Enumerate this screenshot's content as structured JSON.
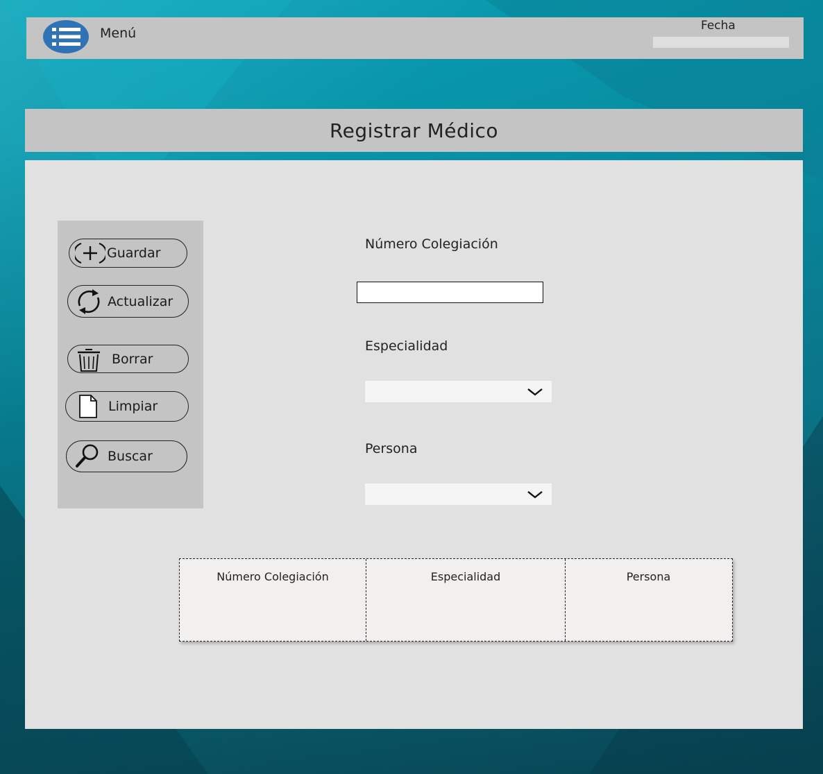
{
  "header": {
    "menu_label": "Menú",
    "date_label": "Fecha",
    "date_value": ""
  },
  "title": "Registrar Médico",
  "toolbar": {
    "buttons": [
      {
        "label": "Guardar",
        "icon": "plus-circle-icon"
      },
      {
        "label": "Actualizar",
        "icon": "refresh-icon"
      },
      {
        "label": "Borrar",
        "icon": "trash-icon"
      },
      {
        "label": "Limpiar",
        "icon": "document-icon"
      },
      {
        "label": "Buscar",
        "icon": "magnifier-icon"
      }
    ]
  },
  "form": {
    "numero_label": "Número Colegiación",
    "numero_value": "",
    "especialidad_label": "Especialidad",
    "especialidad_value": "",
    "persona_label": "Persona",
    "persona_value": ""
  },
  "table": {
    "columns": [
      "Número Colegiación",
      "Especialidad",
      "Persona"
    ]
  },
  "colors": {
    "menu_button": "#2f73b6",
    "bars": "#c4c4c4",
    "panel": "#e1e1e1",
    "background": "#078ea3"
  }
}
